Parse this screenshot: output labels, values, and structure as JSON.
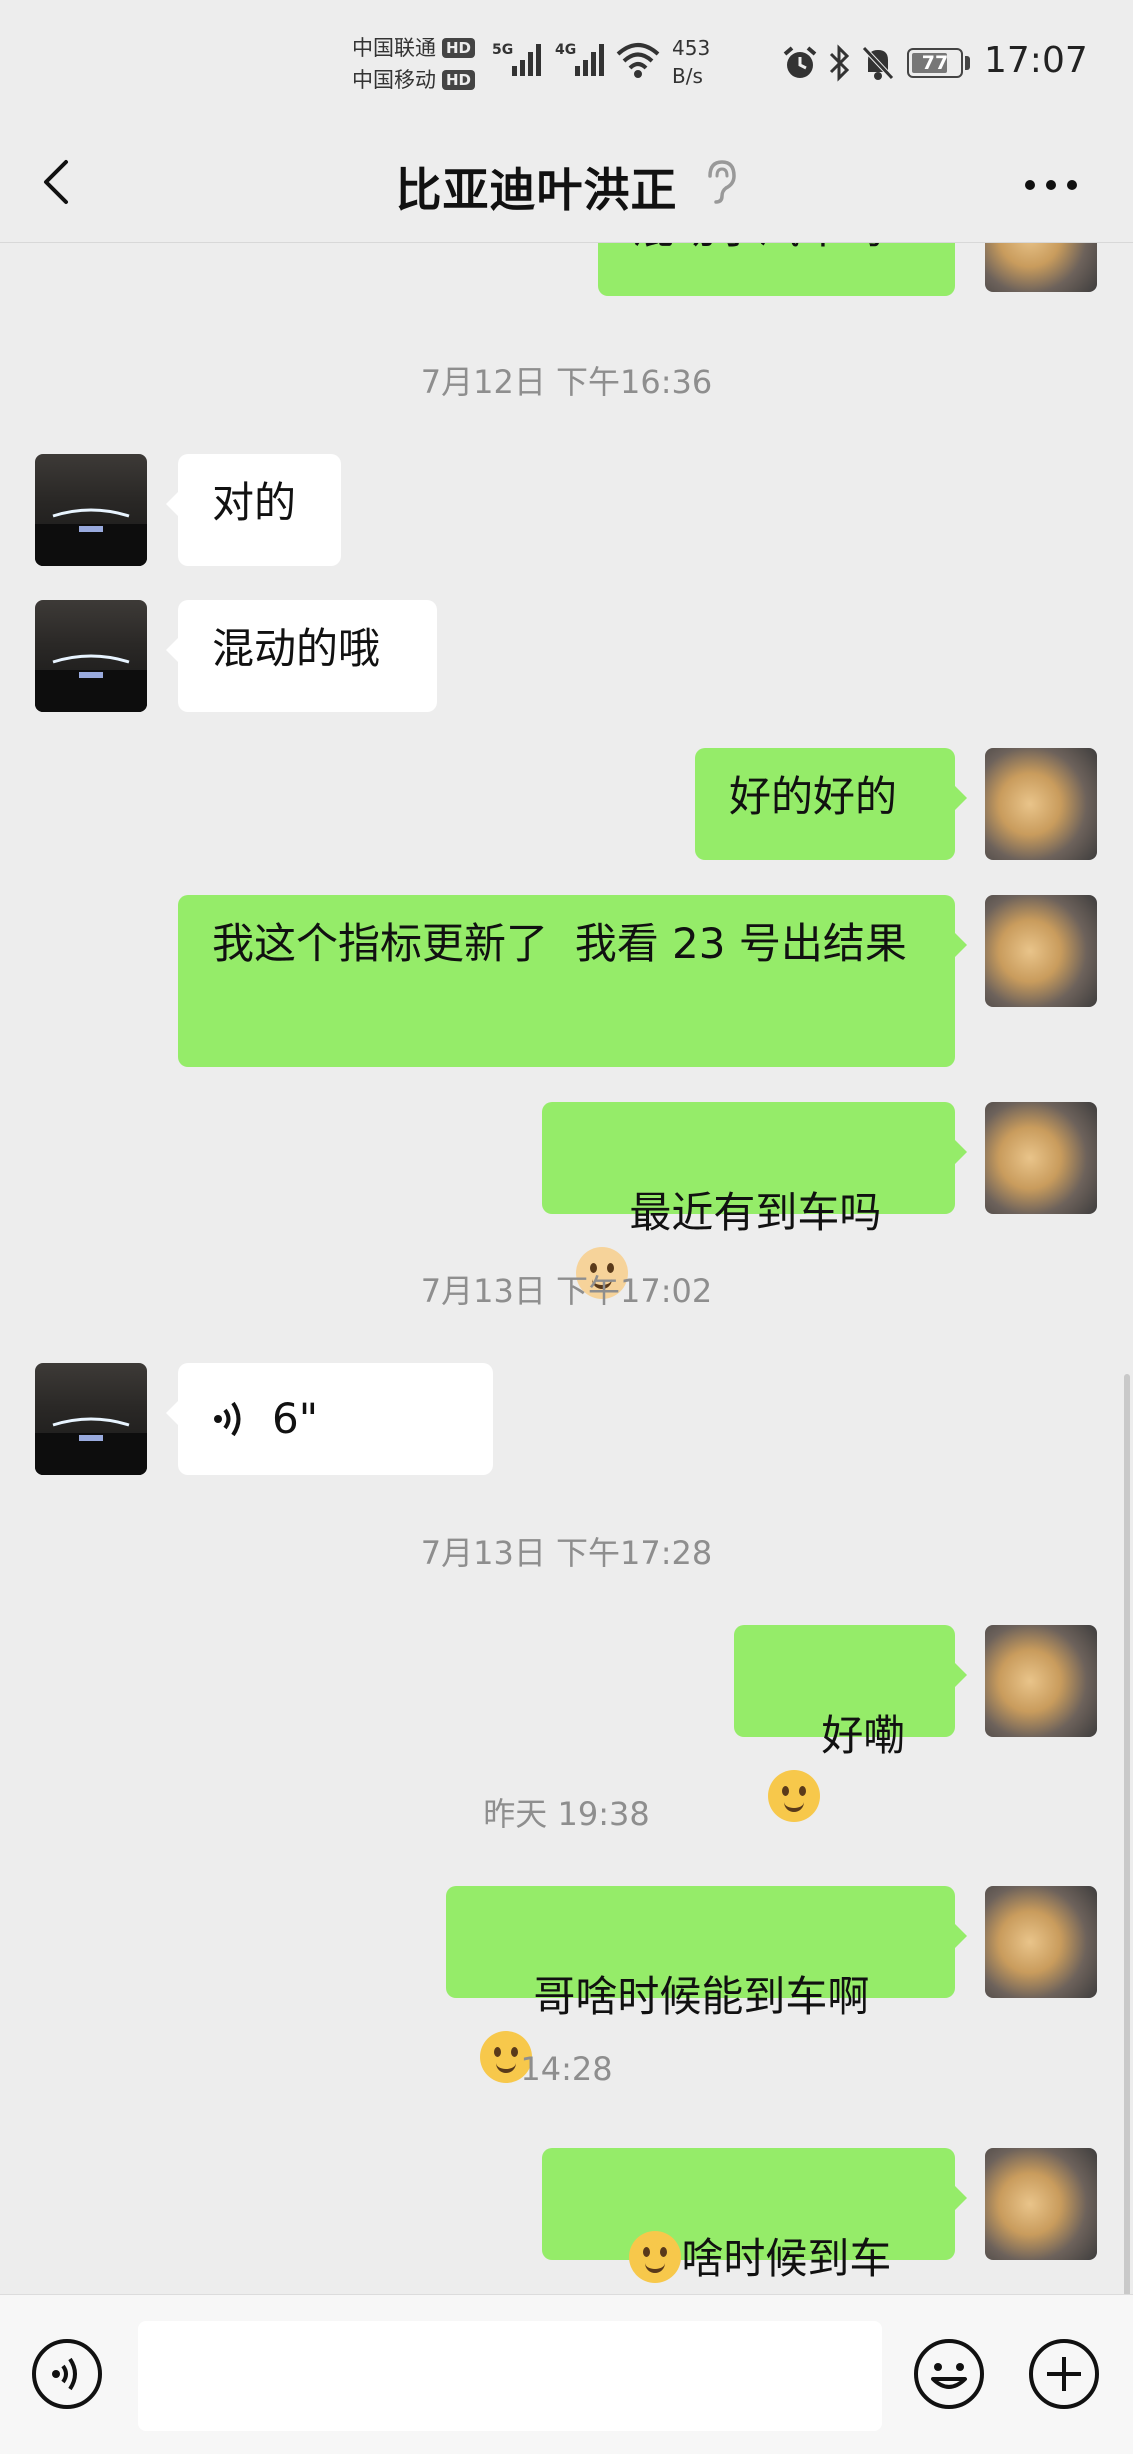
{
  "status_bar": {
    "carrier1": "中国联通",
    "carrier2": "中国移动",
    "hd": "HD",
    "net1": "5G",
    "net2": "4G",
    "speed_value": "453",
    "speed_unit": "B/s",
    "battery": "77",
    "battery_level": 0.77,
    "time": "17:07",
    "icons": [
      "alarm-icon",
      "bluetooth-icon",
      "mute-bell-icon",
      "wifi-icon",
      "signal-icon",
      "battery-icon"
    ]
  },
  "header": {
    "title": "比亚迪叶洪正",
    "icons": [
      "back-arrow-icon",
      "ear-icon",
      "more-icon"
    ]
  },
  "messages": [
    {
      "side": "out",
      "text": "混动小汽车吗"
    },
    {
      "type": "time",
      "text": "7月12日 下午16:36"
    },
    {
      "side": "in",
      "text": "对的"
    },
    {
      "side": "in",
      "text": "混动的哦"
    },
    {
      "side": "out",
      "text": "好的好的"
    },
    {
      "side": "out",
      "text": "我这个指标更新了  我看 23 号出结果"
    },
    {
      "side": "out",
      "text": "最近有到车吗",
      "emoji": "cat-face-emoji"
    },
    {
      "type": "time",
      "text": "7月13日 下午17:02"
    },
    {
      "side": "in",
      "type": "voice",
      "text": "6\""
    },
    {
      "type": "time",
      "text": "7月13日 下午17:28"
    },
    {
      "side": "out",
      "text": "好嘞",
      "emoji": "thinking-emoji"
    },
    {
      "type": "time",
      "text": "昨天 19:38"
    },
    {
      "side": "out",
      "text": "哥啥时候能到车啊",
      "emoji": "crying-emoji"
    },
    {
      "type": "time",
      "text": "14:28"
    },
    {
      "side": "out",
      "text": "啥时候到车啊",
      "emoji_before": "crying-emoji"
    }
  ],
  "input_bar": {
    "value": "",
    "icons": [
      "voice-input-icon",
      "emoji-icon",
      "plus-icon"
    ]
  }
}
